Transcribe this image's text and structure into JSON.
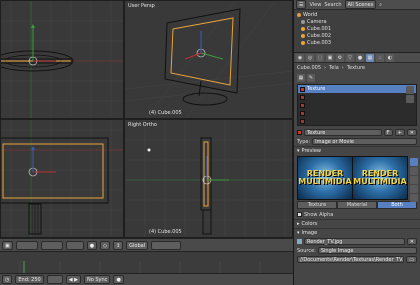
{
  "viewports": {
    "top_left": {
      "title": "",
      "footer": ""
    },
    "top_right": {
      "title": "User Persp",
      "footer": "(4) Cube.005"
    },
    "bottom_left": {
      "title": "",
      "footer": ""
    },
    "bottom_right": {
      "title": "Right Ortho",
      "footer": "(4) Cube.005"
    }
  },
  "header3d": {
    "pivot": "Global"
  },
  "timeline": {
    "end_label": "End: 250",
    "sync": "No Sync"
  },
  "outliner": {
    "view": "View",
    "search": "Search",
    "scenes": "All Scenes",
    "items": [
      {
        "name": "World",
        "color": "#d94"
      },
      {
        "name": "Camera",
        "color": "#999"
      },
      {
        "name": "Cube.001",
        "color": "#e9a33b"
      },
      {
        "name": "Cube.002",
        "color": "#e9a33b"
      },
      {
        "name": "Cube.003",
        "color": "#e9a33b"
      }
    ]
  },
  "properties": {
    "breadcrumb": [
      "Cube.005",
      "Tela",
      "Texture"
    ],
    "slots": [
      "Texture",
      "",
      "",
      "",
      ""
    ],
    "texture_name": "Texture",
    "type_label": "Type:",
    "type_value": "Image or Movie",
    "preview_section": "Preview",
    "preview_text_line1": "RENDER",
    "preview_text_line2": "MULTIMIDIA",
    "preview_tabs": [
      "Texture",
      "Material",
      "Both"
    ],
    "show_alpha": "Show Alpha",
    "colors_section": "Colors",
    "image_section": "Image",
    "image_file": "Render_TV.jpg",
    "source_label": "Source:",
    "source_value": "Single Image",
    "filepath": "//Documents\\Render\\Texturas\\Render_TV.jpg"
  }
}
